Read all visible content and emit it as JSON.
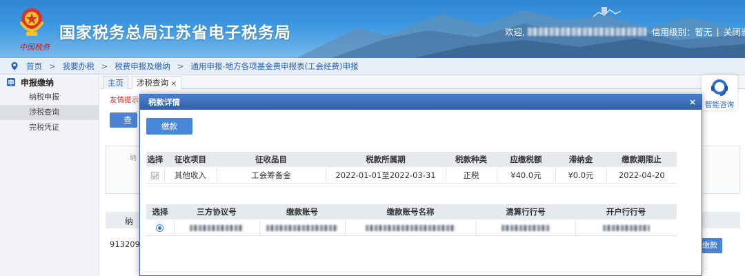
{
  "header": {
    "title": "国家税务总局江苏省电子税务局",
    "logo_subtext": "中国税务",
    "welcome_label": "欢迎,",
    "credit_level": "信用级别：暂无",
    "separator": "|",
    "close_link": "关闭当页"
  },
  "breadcrumb": [
    {
      "label": "首页"
    },
    {
      "label": "我要办税"
    },
    {
      "label": "税费申报及缴纳"
    },
    {
      "label": "通用申报-地方各项基金费申报表(工会经费)申报"
    }
  ],
  "breadcrumb_separator": ">",
  "sidebar": {
    "section_icon": "申",
    "section_title": "申报缴纳",
    "items": [
      {
        "label": "纳税申报",
        "active": false
      },
      {
        "label": "涉税查询",
        "active": true
      },
      {
        "label": "完税凭证",
        "active": false
      }
    ]
  },
  "tabs": [
    {
      "label": "主页",
      "active": false
    },
    {
      "label": "涉税查询",
      "active": true,
      "close": "×"
    }
  ],
  "background": {
    "tip_text": "友情提示",
    "query_button": "查询",
    "box_label": "纳",
    "strip_label": "纳",
    "row_prefix": "913209",
    "row_button": "缴款"
  },
  "consult": {
    "label": "智能咨询",
    "icon": "headset-icon"
  },
  "modal": {
    "title": "税款详情",
    "close": "×",
    "pay_button": "缴款",
    "tax_table": {
      "columns": [
        "选择",
        "征收项目",
        "征收品目",
        "税款所属期",
        "税款种类",
        "应缴税额",
        "滞纳金",
        "缴款期限止"
      ],
      "rows": [
        [
          "",
          "其他收入",
          "工会筹备金",
          "2022-01-01至2022-03-31",
          "正税",
          "¥40.0元",
          "¥0.0元",
          "2022-04-20"
        ]
      ]
    },
    "account_table": {
      "columns": [
        "选择",
        "三方协议号",
        "缴款账号",
        "缴款账号名称",
        "清算行行号",
        "开户行行号"
      ]
    }
  },
  "colors": {
    "header_blue": "#2f86d3",
    "primary_button": "#4a86d8",
    "modal_title": "#2f60ac",
    "tip_red": "#d9342b",
    "link_blue": "#2a61b0"
  }
}
